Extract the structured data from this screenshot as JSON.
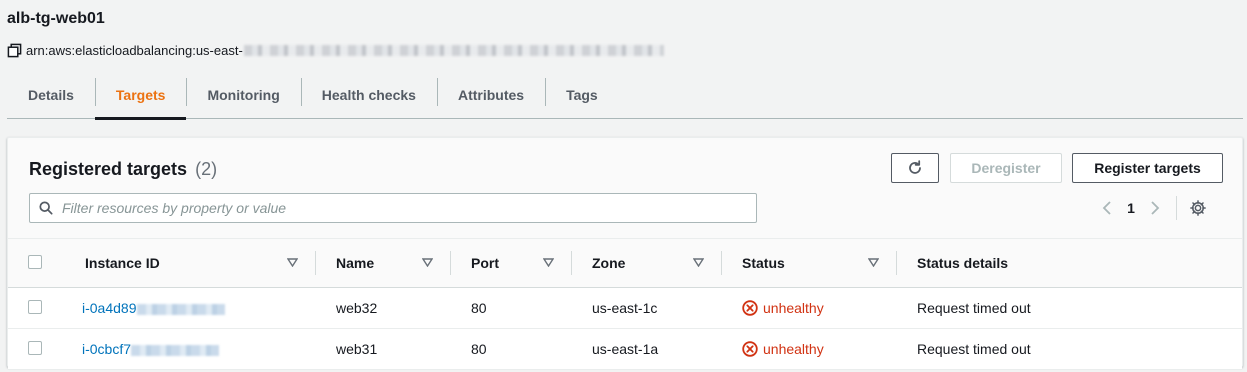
{
  "header": {
    "title": "alb-tg-web01",
    "arn_prefix": "arn:aws:elasticloadbalancing:us-east-"
  },
  "tabs": [
    {
      "label": "Details",
      "active": false
    },
    {
      "label": "Targets",
      "active": true
    },
    {
      "label": "Monitoring",
      "active": false
    },
    {
      "label": "Health checks",
      "active": false
    },
    {
      "label": "Attributes",
      "active": false
    },
    {
      "label": "Tags",
      "active": false
    }
  ],
  "panel": {
    "title": "Registered targets",
    "count": "(2)",
    "deregister_label": "Deregister",
    "register_label": "Register targets",
    "search_placeholder": "Filter resources by property or value",
    "page": "1"
  },
  "table": {
    "columns": [
      "Instance ID",
      "Name",
      "Port",
      "Zone",
      "Status",
      "Status details"
    ],
    "rows": [
      {
        "instance_id": "i-0a4d89",
        "name": "web32",
        "port": "80",
        "zone": "us-east-1c",
        "status": "unhealthy",
        "status_details": "Request timed out"
      },
      {
        "instance_id": "i-0cbcf7",
        "name": "web31",
        "port": "80",
        "zone": "us-east-1a",
        "status": "unhealthy",
        "status_details": "Request timed out"
      }
    ]
  },
  "colors": {
    "accent": "#ec7211",
    "link": "#0073bb",
    "error": "#d13212"
  }
}
